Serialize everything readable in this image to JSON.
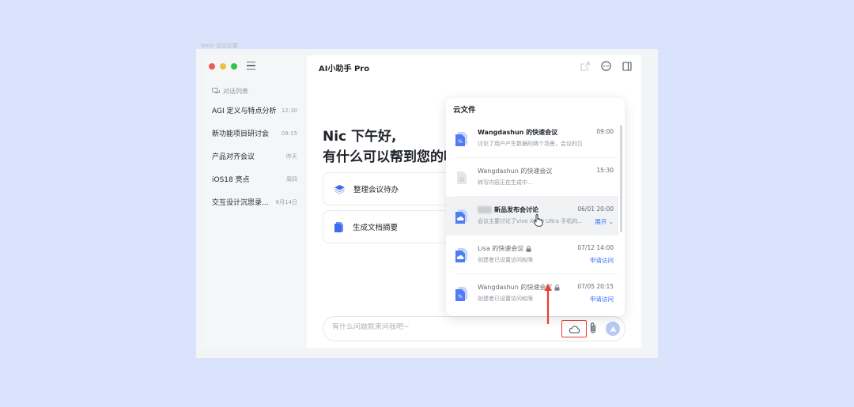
{
  "background_color": "#d9e3fb",
  "accent_color": "#3370ff",
  "highlight_color": "#ea3d2f",
  "window": {
    "faint_label": "Nmir 会议纪要",
    "title": "AI小助手 Pro"
  },
  "sidebar": {
    "list_header": "对话列表",
    "items": [
      {
        "title": "AGI 定义与特点分析",
        "time": "12:30"
      },
      {
        "title": "新功能项目研讨会",
        "time": "09:15"
      },
      {
        "title": "产品对齐会议",
        "time": "昨天"
      },
      {
        "title": "iOS18 亮点",
        "time": "周四"
      },
      {
        "title": "交互设计沉思录...",
        "time": "6月14日"
      }
    ]
  },
  "main": {
    "greeting_line1": "Nic 下午好,",
    "greeting_line2": "有什么可以帮到您的吗",
    "actions": [
      {
        "label": "整理会议待办",
        "icon": "layers-icon"
      },
      {
        "label": "生成文档摘要",
        "icon": "document-icon"
      }
    ],
    "input_placeholder": "有什么问题就来问我吧~"
  },
  "cloud_popup": {
    "title": "云文件",
    "files": [
      {
        "name": "Wangdashun 的快速会议",
        "desc": "讨论了用户产生数据的两个场景，会议的沉淀...",
        "date": "09:00",
        "link": "",
        "locked": false,
        "state": "ready"
      },
      {
        "name": "Wangdashun 的快速会议",
        "desc": "转写内容正在生成中...",
        "date": "15:30",
        "link": "",
        "locked": false,
        "state": "processing"
      },
      {
        "name": "新品发布会讨论",
        "desc": "会议主要讨论了vivo X100 Ultra 手机的...",
        "date": "06/01  20:00",
        "link": "展开",
        "locked": false,
        "state": "ready"
      },
      {
        "name": "Lisa 的快速会议",
        "desc": "创建者已设置访问权限",
        "date": "07/12 14:00",
        "link": "申请访问",
        "locked": true,
        "state": "locked"
      },
      {
        "name": "Wangdashun 的快速会议",
        "desc": "创建者已设置访问权限",
        "date": "07/05 20:15",
        "link": "申请访问",
        "locked": true,
        "state": "locked"
      }
    ]
  }
}
